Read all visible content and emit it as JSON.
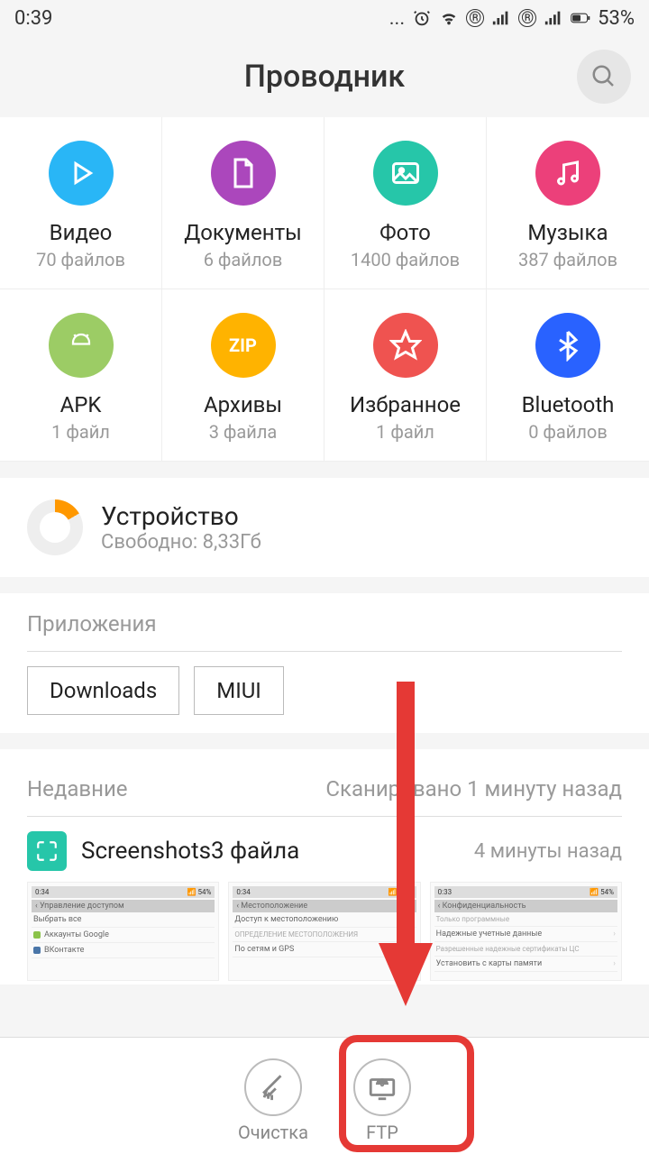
{
  "status": {
    "time": "0:39",
    "battery": "53%",
    "reg": "®"
  },
  "header": {
    "title": "Проводник"
  },
  "categories": [
    {
      "label": "Видео",
      "count": "70 файлов",
      "color": "#29b6f6"
    },
    {
      "label": "Документы",
      "count": "6 файлов",
      "color": "#ab47bc"
    },
    {
      "label": "Фото",
      "count": "1400 файлов",
      "color": "#26c6a9"
    },
    {
      "label": "Музыка",
      "count": "387 файлов",
      "color": "#ec407a"
    },
    {
      "label": "APK",
      "count": "1 файл",
      "color": "#9ccc65"
    },
    {
      "label": "Архивы",
      "count": "3 файла",
      "color": "#ffb300"
    },
    {
      "label": "Избранное",
      "count": "1 файл",
      "color": "#ef5350"
    },
    {
      "label": "Bluetooth",
      "count": "0 файлов",
      "color": "#2962ff"
    }
  ],
  "storage": {
    "title": "Устройство",
    "free": "Свободно: 8,33Гб"
  },
  "apps": {
    "title": "Приложения",
    "chips": [
      "Downloads",
      "MIUI"
    ]
  },
  "recent": {
    "title": "Недавние",
    "scan": "Сканировано 1 минуту назад",
    "row": {
      "name": "Screenshots3 файла",
      "time": "4 минуты назад"
    },
    "thumbs": [
      {
        "stime": "0:34",
        "header": "Управление доступом",
        "lines": [
          "Выбрать все",
          "Аккаунты Google",
          "ВКонтакте"
        ]
      },
      {
        "stime": "0:34",
        "header": "Местоположение",
        "lines": [
          "Доступ к местоположению",
          "ОПРЕДЕЛЕНИЕ МЕСТОПОЛОЖЕНИЯ",
          "По сетям и GPS"
        ]
      },
      {
        "stime": "0:33",
        "header": "Конфиденциальность",
        "lines": [
          "Надежные учетные данные",
          "Установить с карты памяти"
        ]
      }
    ]
  },
  "bottom": {
    "clean": "Очистка",
    "ftp": "FTP"
  }
}
